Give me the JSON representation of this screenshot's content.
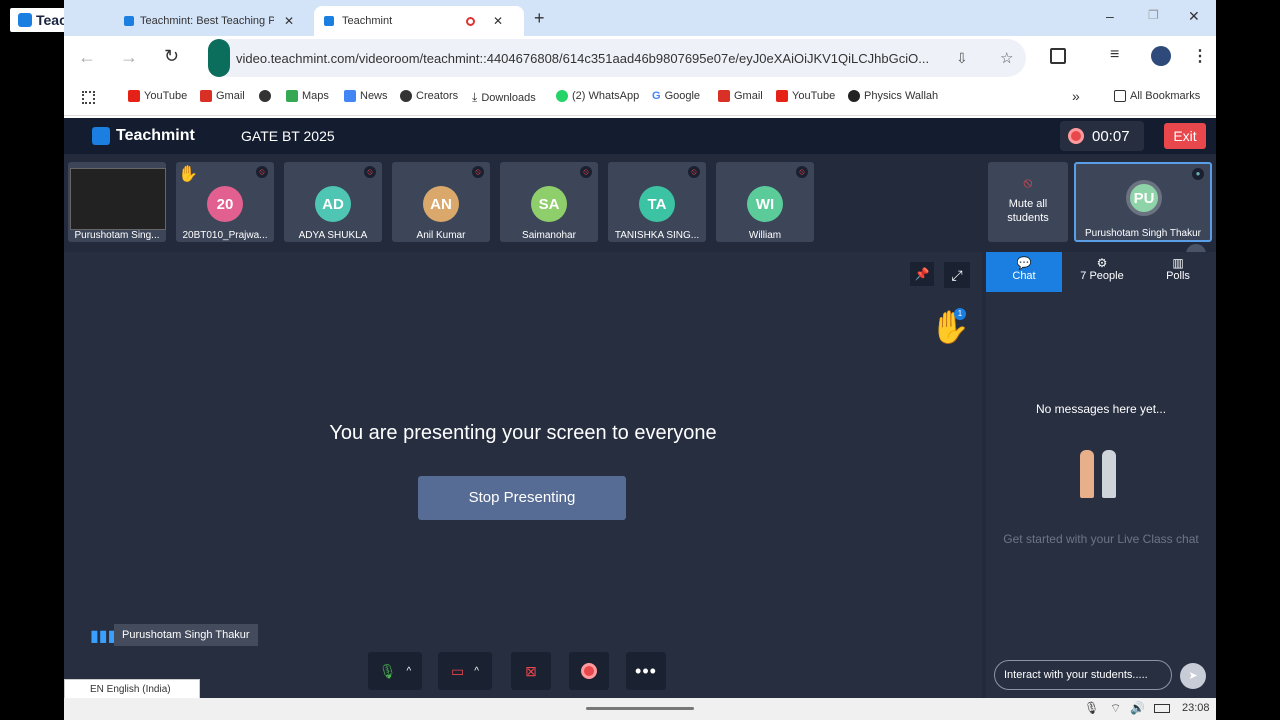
{
  "tabs": {
    "pinned_label": "Teachmint",
    "tab1": "Teachmint: Best Teaching Pl",
    "tab2": "Teachmint",
    "new_tab": "+"
  },
  "window_controls": {
    "minimize": "–",
    "restore": "❐",
    "close": "✕"
  },
  "address": {
    "url": "video.teachmint.com/videoroom/teachmint::4404676808/614c351aad46b9807695e07e/eyJ0eXAiOiJKV1QiLCJhbGciO..."
  },
  "bookmarks": {
    "items": [
      "YouTube",
      "Gmail",
      "",
      "Maps",
      "News",
      "Creators",
      "Downloads",
      "(2) WhatsApp",
      "Google",
      "Gmail",
      "YouTube",
      "Physics Wallah"
    ],
    "more": "»",
    "all": "All Bookmarks"
  },
  "app": {
    "brand": "Teachmint",
    "class_name": "GATE BT 2025",
    "timer": "00:07",
    "exit_label": "Exit",
    "participants": [
      {
        "initials": "",
        "name": "Purushotam Sing..."
      },
      {
        "initials": "20",
        "name": "20BT010_Prajwa...",
        "color": "#e1608f"
      },
      {
        "initials": "AD",
        "name": "ADYA SHUKLA",
        "color": "#4fc6b3"
      },
      {
        "initials": "AN",
        "name": "Anil Kumar",
        "color": "#d9a86a"
      },
      {
        "initials": "SA",
        "name": "Saimanohar",
        "color": "#8fcf6b"
      },
      {
        "initials": "TA",
        "name": "TANISHKA SING...",
        "color": "#3cc3a3"
      },
      {
        "initials": "WI",
        "name": "William",
        "color": "#5bcb9a"
      }
    ],
    "mute_all": "Mute all students",
    "host_tile": {
      "initials": "PU",
      "name": "Purushotam Singh Thakur"
    },
    "presenting_text": "You are presenting your screen to everyone",
    "stop_presenting": "Stop Presenting",
    "speaker_name": "Purushotam Singh Thakur",
    "hand_count": "1",
    "side_tabs": {
      "chat": "Chat",
      "people": "7 People",
      "polls": "Polls"
    },
    "no_messages": "No messages here yet...",
    "get_started": "Get started with your Live Class chat",
    "chat_placeholder": "Interact with your students....."
  },
  "language": "EN English (India)",
  "clock": "23:08",
  "colors": {
    "accent": "#1a7fe0",
    "exit": "#e8474c",
    "topbar": "#141c2f",
    "stage": "#262e40"
  }
}
